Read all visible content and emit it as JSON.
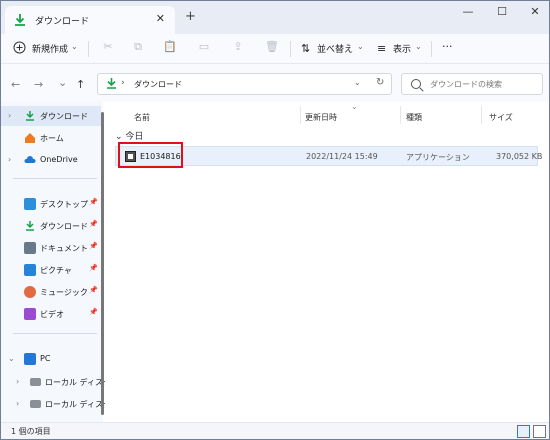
{
  "window": {
    "tab_title": "ダウンロード",
    "tab_close": "✕",
    "new_tab": "+",
    "controls": {
      "minimize": "—",
      "maximize": "☐",
      "close": "✕"
    }
  },
  "commandbar": {
    "new_label": "新規作成",
    "new_icon": "plus-circle-icon",
    "sort_label": "並べ替え",
    "view_label": "表示",
    "more_label": "···",
    "disabled_icons": [
      "cut-icon",
      "copy-icon",
      "paste-icon",
      "rename-icon",
      "share-icon",
      "delete-icon"
    ]
  },
  "navigation": {
    "back": "←",
    "forward": "→",
    "history": "⌄",
    "up": "↑",
    "address_path": "ダウンロード",
    "search_placeholder": "ダウンロードの検索"
  },
  "sidebar": {
    "items": [
      {
        "label": "ダウンロード",
        "icon": "download-icon",
        "selected": true
      },
      {
        "label": "ホーム",
        "icon": "home-icon"
      },
      {
        "label": "OneDrive",
        "icon": "cloud-icon"
      },
      {
        "label": "デスクトップ",
        "icon": "desktop-icon"
      },
      {
        "label": "ダウンロード",
        "icon": "download-icon"
      },
      {
        "label": "ドキュメント",
        "icon": "document-icon"
      },
      {
        "label": "ピクチャ",
        "icon": "picture-icon"
      },
      {
        "label": "ミュージック",
        "icon": "music-icon"
      },
      {
        "label": "ビデオ",
        "icon": "video-icon"
      },
      {
        "label": "PC",
        "icon": "pc-icon"
      },
      {
        "label": "ローカル ディスク",
        "icon": "local-disk-icon"
      },
      {
        "label": "ローカル ディスク",
        "icon": "local-disk-icon"
      }
    ]
  },
  "file_list": {
    "columns": [
      "名前",
      "更新日時",
      "種類",
      "サイズ"
    ],
    "group_label": "今日",
    "rows": [
      {
        "name": "E1034816",
        "modified": "2022/11/24 15:49",
        "type": "アプリケーション",
        "size": "370,052 KB"
      }
    ]
  },
  "status": {
    "item_count": "1 個の項目"
  },
  "colors": {
    "accent": "#2c7cd6",
    "highlight_border": "#e0101a",
    "selection": "#e8f1fb"
  }
}
